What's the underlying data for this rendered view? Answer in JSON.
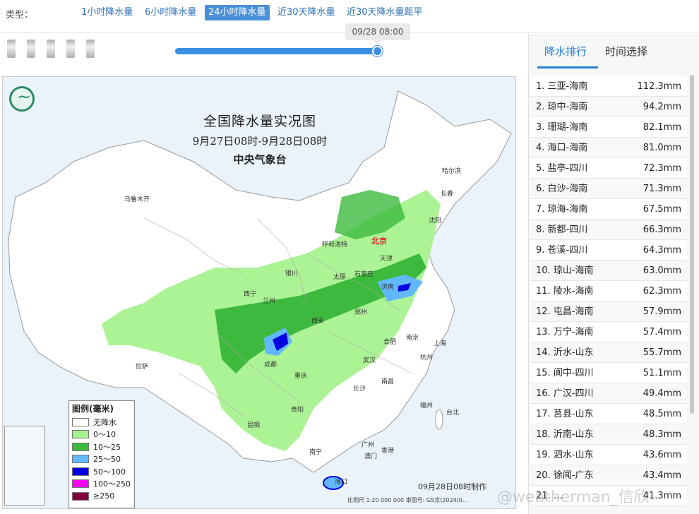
{
  "type_row": {
    "label": "类型：",
    "tabs": [
      "1小时降水量",
      "6小时降水量",
      "24小时降水量",
      "近30天降水量",
      "近30天降水量距平"
    ],
    "active_index": 2
  },
  "timeline": {
    "tooltip": "09/28 08:00",
    "progress": 1.0
  },
  "map": {
    "title": "全国降水量实况图",
    "period": "9月27日08时-9月28日08时",
    "issuer": "中央气象台",
    "made_time": "09月28日08时制作",
    "scale_text": "比例尺 1:20 000 000    审图号: GS京(2024)0…",
    "cities": [
      {
        "name": "乌鲁木齐"
      },
      {
        "name": "哈尔滨"
      },
      {
        "name": "长春"
      },
      {
        "name": "沈阳"
      },
      {
        "name": "北京",
        "capital": true
      },
      {
        "name": "天津"
      },
      {
        "name": "呼和浩特"
      },
      {
        "name": "银川"
      },
      {
        "name": "太原"
      },
      {
        "name": "石家庄"
      },
      {
        "name": "济南"
      },
      {
        "name": "西宁"
      },
      {
        "name": "兰州"
      },
      {
        "name": "西安"
      },
      {
        "name": "郑州"
      },
      {
        "name": "合肥"
      },
      {
        "name": "南京"
      },
      {
        "name": "上海"
      },
      {
        "name": "杭州"
      },
      {
        "name": "拉萨"
      },
      {
        "name": "成都"
      },
      {
        "name": "重庆"
      },
      {
        "name": "武汉"
      },
      {
        "name": "长沙"
      },
      {
        "name": "南昌"
      },
      {
        "name": "福州"
      },
      {
        "name": "台北"
      },
      {
        "name": "贵阳"
      },
      {
        "name": "昆明"
      },
      {
        "name": "南宁"
      },
      {
        "name": "广州"
      },
      {
        "name": "香港"
      },
      {
        "name": "澳门"
      },
      {
        "name": "海口"
      }
    ],
    "legend": {
      "title": "图例(毫米)",
      "items": [
        {
          "label": "无降水",
          "color": "#ffffff"
        },
        {
          "label": "0～10",
          "color": "#a6f28f"
        },
        {
          "label": "10～25",
          "color": "#3dba3d"
        },
        {
          "label": "25～50",
          "color": "#61b8ff"
        },
        {
          "label": "50～100",
          "color": "#0000e1"
        },
        {
          "label": "100～250",
          "color": "#fa00fa"
        },
        {
          "label": "≥250",
          "color": "#800040"
        }
      ]
    }
  },
  "sidebar": {
    "tabs": [
      "降水排行",
      "时间选择"
    ],
    "active_tab": 0,
    "ranking": [
      {
        "rank": "1.",
        "station": "三亚-海南",
        "value": "112.3mm"
      },
      {
        "rank": "2.",
        "station": "琼中-海南",
        "value": "94.2mm"
      },
      {
        "rank": "3.",
        "station": "珊瑚-海南",
        "value": "82.1mm"
      },
      {
        "rank": "4.",
        "station": "海口-海南",
        "value": "81.0mm"
      },
      {
        "rank": "5.",
        "station": "盐亭-四川",
        "value": "72.3mm"
      },
      {
        "rank": "6.",
        "station": "白沙-海南",
        "value": "71.3mm"
      },
      {
        "rank": "7.",
        "station": "琼海-海南",
        "value": "67.5mm"
      },
      {
        "rank": "8.",
        "station": "新都-四川",
        "value": "66.3mm"
      },
      {
        "rank": "9.",
        "station": "苍溪-四川",
        "value": "64.3mm"
      },
      {
        "rank": "10.",
        "station": "琼山-海南",
        "value": "63.0mm"
      },
      {
        "rank": "11.",
        "station": "陵水-海南",
        "value": "62.3mm"
      },
      {
        "rank": "12.",
        "station": "屯昌-海南",
        "value": "57.9mm"
      },
      {
        "rank": "13.",
        "station": "万宁-海南",
        "value": "57.4mm"
      },
      {
        "rank": "14.",
        "station": "沂水-山东",
        "value": "55.7mm"
      },
      {
        "rank": "15.",
        "station": "阆中-四川",
        "value": "51.1mm"
      },
      {
        "rank": "16.",
        "station": "广汉-四川",
        "value": "49.4mm"
      },
      {
        "rank": "17.",
        "station": "莒县-山东",
        "value": "48.5mm"
      },
      {
        "rank": "18.",
        "station": "沂南-山东",
        "value": "48.3mm"
      },
      {
        "rank": "19.",
        "station": "泗水-山东",
        "value": "43.6mm"
      },
      {
        "rank": "20.",
        "station": "徐闻-广东",
        "value": "43.4mm"
      },
      {
        "rank": "21.",
        "station": "…",
        "value": "41.3mm"
      }
    ]
  },
  "watermark": "@weatherman_信欣"
}
